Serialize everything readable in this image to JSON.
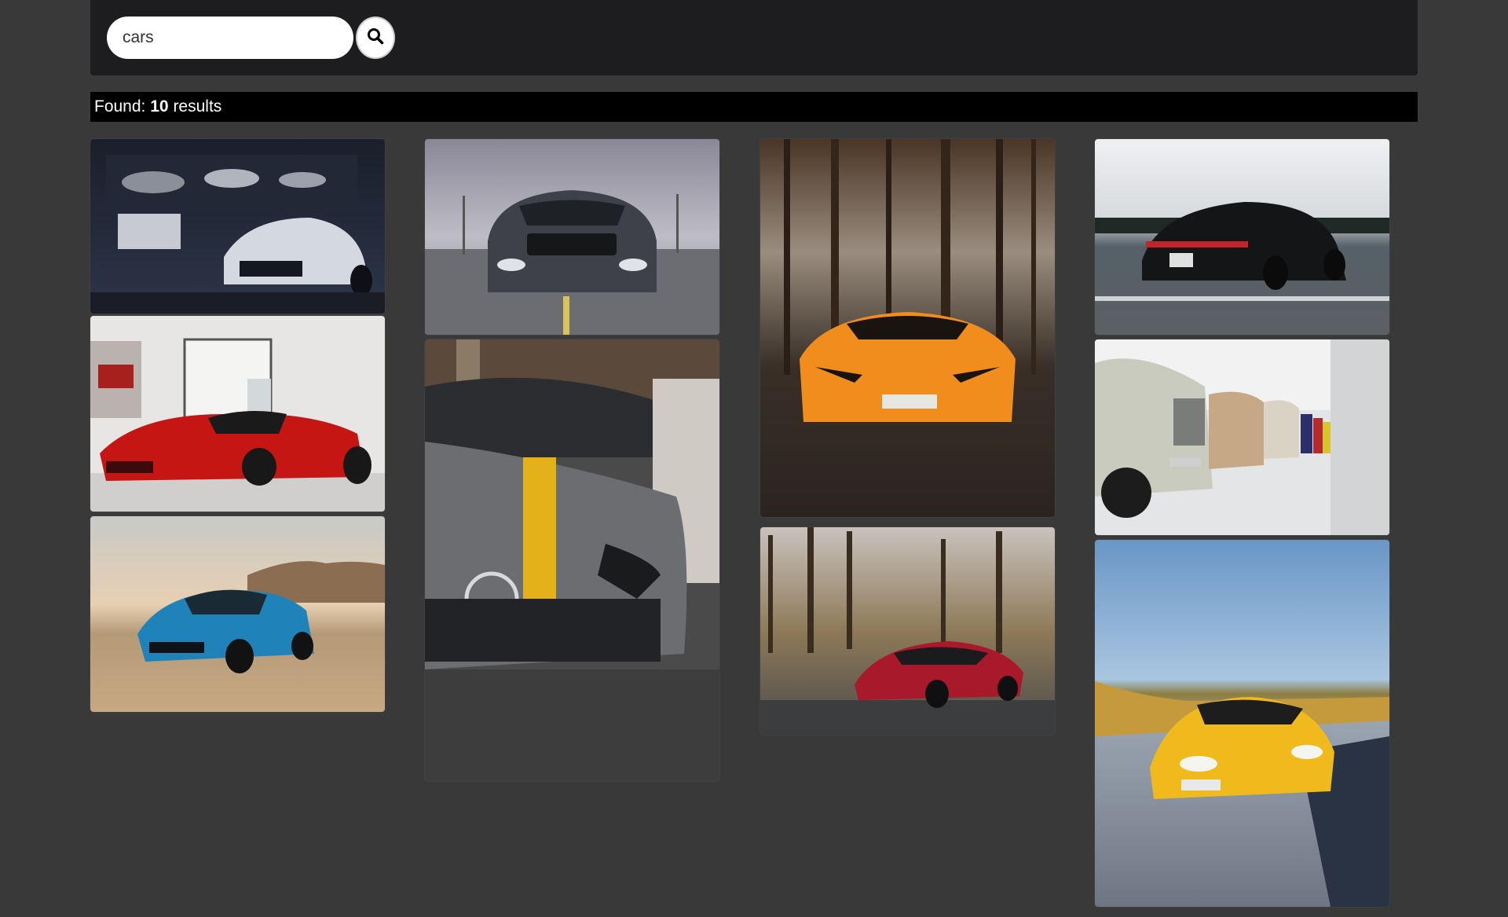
{
  "search": {
    "value": "cars",
    "placeholder": "Search",
    "button_icon": "search-icon"
  },
  "results": {
    "prefix": "Found:",
    "count": "10",
    "suffix": "results"
  },
  "gallery": {
    "images": [
      {
        "subject": "white-camaro-in-garage"
      },
      {
        "subject": "red-laferrari-showroom"
      },
      {
        "subject": "blue-camaro-desert"
      },
      {
        "subject": "gray-mustang-front"
      },
      {
        "subject": "gray-mercedes-yellow-stripe"
      },
      {
        "subject": "orange-lamborghini-forest"
      },
      {
        "subject": "red-mercedes-amg-gt"
      },
      {
        "subject": "black-porsche-panamera"
      },
      {
        "subject": "row-of-classic-bmws"
      },
      {
        "subject": "yellow-mercedes-amg-gt"
      }
    ]
  }
}
